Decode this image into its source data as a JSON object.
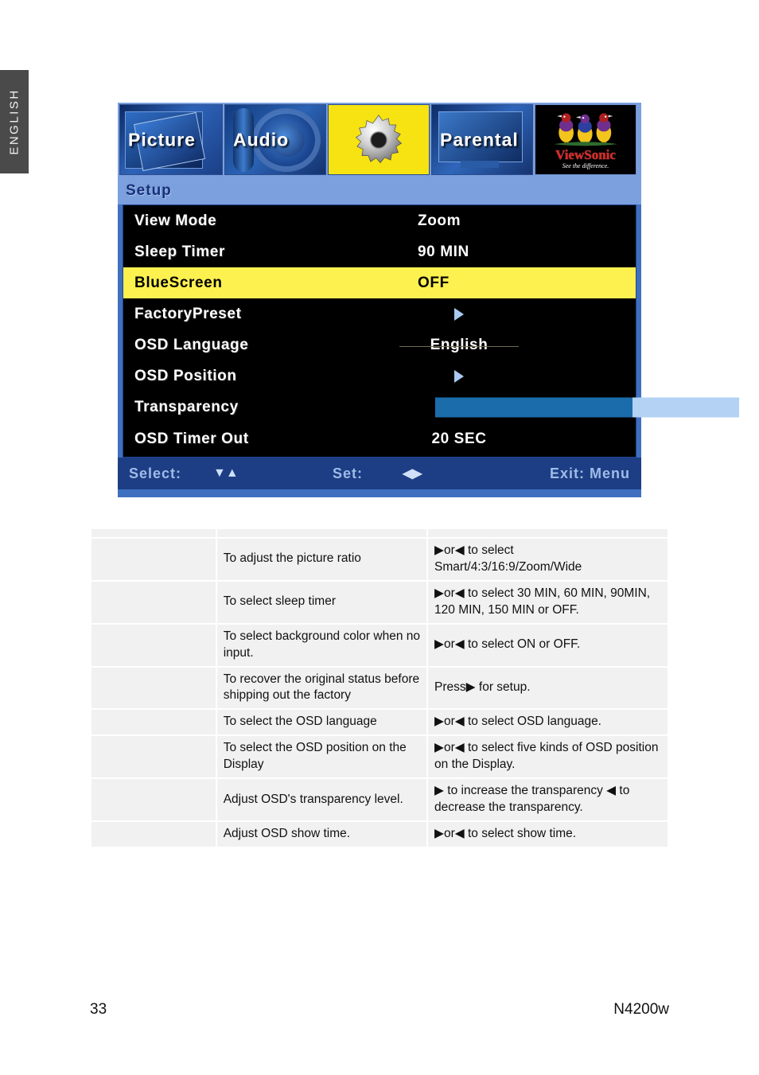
{
  "side_tab": {
    "label": "ENGLISH"
  },
  "osd": {
    "tabs": [
      {
        "name": "picture",
        "label": "Picture",
        "active": false
      },
      {
        "name": "audio",
        "label": "Audio",
        "active": false
      },
      {
        "name": "setup",
        "label": "",
        "active": true
      },
      {
        "name": "parental",
        "label": "Parental",
        "active": false
      }
    ],
    "brand": {
      "name": "ViewSonic",
      "tagline": "See the difference."
    },
    "header_title": "Setup",
    "rows": [
      {
        "label": "View Mode",
        "value": "Zoom",
        "type": "text"
      },
      {
        "label": "Sleep Timer",
        "value": "90 MIN",
        "type": "text"
      },
      {
        "label": "BlueScreen",
        "value": "OFF",
        "type": "text",
        "highlight": true
      },
      {
        "label": "FactoryPreset",
        "value": "",
        "type": "arrow"
      },
      {
        "label": "OSD Language",
        "value": "English",
        "type": "text-underline"
      },
      {
        "label": "OSD Position",
        "value": "",
        "type": "arrow"
      },
      {
        "label": "Transparency",
        "value": "70",
        "type": "slider",
        "percent": 65
      },
      {
        "label": "OSD Timer Out",
        "value": "20 SEC",
        "type": "text"
      }
    ],
    "footer": {
      "select_label": "Select:",
      "select_arrows": "▼▲",
      "set_label": "Set:",
      "set_arrows": "◀▶",
      "exit_label": "Exit: Menu"
    },
    "colors": {
      "highlight": "#fdf14f",
      "panel_blue": "#7ba0dd",
      "footer_blue": "#1d3e84",
      "slider_fill": "#1b6cab",
      "slider_track": "#b3d2f4",
      "brand_red": "#d82a2a"
    }
  },
  "table": {
    "rows": [
      {
        "c1": "",
        "c2": "",
        "c3": ""
      },
      {
        "c1": "",
        "c2": "To adjust the picture ratio",
        "c3": "▶or◀ to select\nSmart/4:3/16:9/Zoom/Wide"
      },
      {
        "c1": "",
        "c2": "To select sleep timer",
        "c3": "▶or◀ to select 30 MIN, 60 MIN, 90MIN, 120 MIN, 150 MIN or OFF."
      },
      {
        "c1": "",
        "c2": "To select background color when no input.",
        "c3": "▶or◀ to select ON or OFF."
      },
      {
        "c1": "",
        "c2": "To recover the original status before shipping out the factory",
        "c3": "Press▶ for setup."
      },
      {
        "c1": "",
        "c2": "To select the OSD language",
        "c3": "▶or◀ to select OSD language."
      },
      {
        "c1": "",
        "c2": "To select the OSD position on the Display",
        "c3": "▶or◀ to select five kinds of OSD position on the Display."
      },
      {
        "c1": "",
        "c2": "Adjust OSD's transparency level.",
        "c3": "▶ to increase the transparency ◀ to decrease the transparency."
      },
      {
        "c1": "",
        "c2": "Adjust OSD show time.",
        "c3": "▶or◀ to select show time."
      }
    ]
  },
  "footer": {
    "page_number": "33",
    "model": "N4200w"
  }
}
